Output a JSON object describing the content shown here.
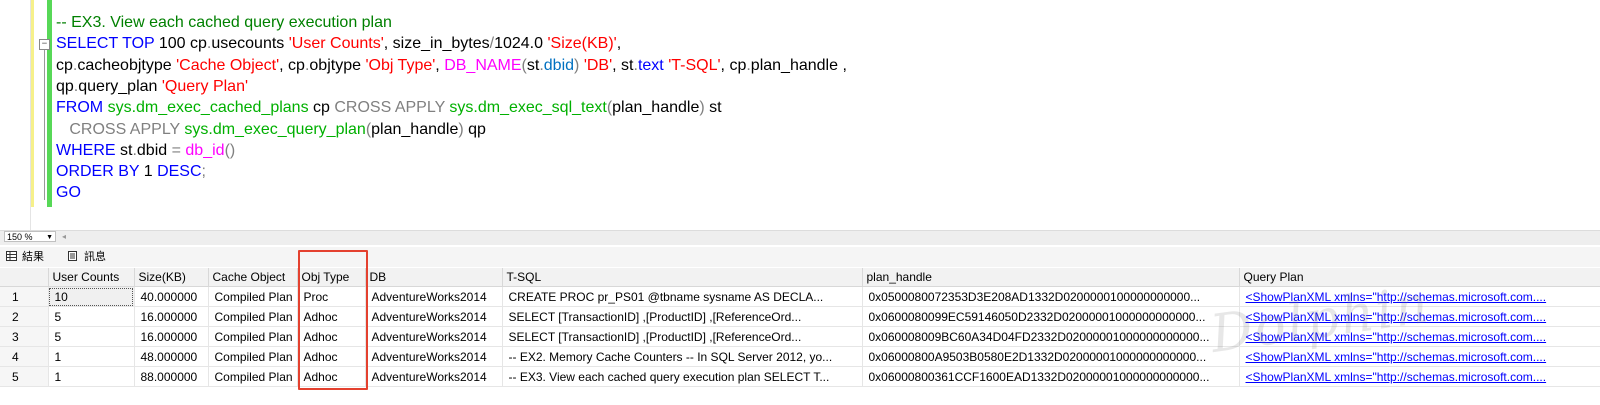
{
  "editor": {
    "lines": [
      [
        {
          "t": "-- EX3. View each cached query execution plan",
          "c": "cmt"
        }
      ],
      [
        {
          "t": "SELECT",
          "c": "kw"
        },
        {
          "t": " ",
          "c": "plain"
        },
        {
          "t": "TOP",
          "c": "kw"
        },
        {
          "t": " 100 cp",
          "c": "plain"
        },
        {
          "t": ".",
          "c": "gray"
        },
        {
          "t": "usecounts ",
          "c": "plain"
        },
        {
          "t": "'User Counts'",
          "c": "str"
        },
        {
          "t": ", size_in_bytes",
          "c": "plain"
        },
        {
          "t": "/",
          "c": "gray"
        },
        {
          "t": "1024.0 ",
          "c": "plain"
        },
        {
          "t": "'Size(KB)'",
          "c": "str"
        },
        {
          "t": ",",
          "c": "plain"
        }
      ],
      [
        {
          "t": "cp",
          "c": "plain"
        },
        {
          "t": ".",
          "c": "gray"
        },
        {
          "t": "cacheobjtype ",
          "c": "plain"
        },
        {
          "t": "'Cache Object'",
          "c": "str"
        },
        {
          "t": ", cp",
          "c": "plain"
        },
        {
          "t": ".",
          "c": "gray"
        },
        {
          "t": "objtype ",
          "c": "plain"
        },
        {
          "t": "'Obj Type'",
          "c": "str"
        },
        {
          "t": ", ",
          "c": "plain"
        },
        {
          "t": "DB_NAME",
          "c": "fn"
        },
        {
          "t": "(",
          "c": "gray"
        },
        {
          "t": "st",
          "c": "plain"
        },
        {
          "t": ".",
          "c": "gray"
        },
        {
          "t": "dbid",
          "c": "teal"
        },
        {
          "t": ")",
          "c": "gray"
        },
        {
          "t": " ",
          "c": "plain"
        },
        {
          "t": "'DB'",
          "c": "str"
        },
        {
          "t": ", st",
          "c": "plain"
        },
        {
          "t": ".",
          "c": "gray"
        },
        {
          "t": "text",
          "c": "kw"
        },
        {
          "t": " ",
          "c": "plain"
        },
        {
          "t": "'T-SQL'",
          "c": "str"
        },
        {
          "t": ", cp",
          "c": "plain"
        },
        {
          "t": ".",
          "c": "gray"
        },
        {
          "t": "plan_handle ,",
          "c": "plain"
        }
      ],
      [
        {
          "t": "qp",
          "c": "plain"
        },
        {
          "t": ".",
          "c": "gray"
        },
        {
          "t": "query_plan ",
          "c": "plain"
        },
        {
          "t": "'Query Plan'",
          "c": "str"
        }
      ],
      [
        {
          "t": "FROM",
          "c": "kw"
        },
        {
          "t": " ",
          "c": "plain"
        },
        {
          "t": "sys.dm_exec_cached_plans",
          "c": "sys"
        },
        {
          "t": " cp ",
          "c": "plain"
        },
        {
          "t": "CROSS APPLY",
          "c": "gray"
        },
        {
          "t": " ",
          "c": "plain"
        },
        {
          "t": "sys.dm_exec_sql_text",
          "c": "sys"
        },
        {
          "t": "(",
          "c": "gray"
        },
        {
          "t": "plan_handle",
          "c": "plain"
        },
        {
          "t": ")",
          "c": "gray"
        },
        {
          "t": " st",
          "c": "plain"
        }
      ],
      [
        {
          "t": "   ",
          "c": "plain"
        },
        {
          "t": "CROSS APPLY",
          "c": "gray"
        },
        {
          "t": " ",
          "c": "plain"
        },
        {
          "t": "sys.dm_exec_query_plan",
          "c": "sys"
        },
        {
          "t": "(",
          "c": "gray"
        },
        {
          "t": "plan_handle",
          "c": "plain"
        },
        {
          "t": ")",
          "c": "gray"
        },
        {
          "t": " qp",
          "c": "plain"
        }
      ],
      [
        {
          "t": "WHERE",
          "c": "kw"
        },
        {
          "t": " st",
          "c": "plain"
        },
        {
          "t": ".",
          "c": "gray"
        },
        {
          "t": "dbid ",
          "c": "plain"
        },
        {
          "t": "=",
          "c": "gray"
        },
        {
          "t": " ",
          "c": "plain"
        },
        {
          "t": "db_id",
          "c": "fn"
        },
        {
          "t": "()",
          "c": "gray"
        }
      ],
      [
        {
          "t": "ORDER BY",
          "c": "kw"
        },
        {
          "t": " 1 ",
          "c": "plain"
        },
        {
          "t": "DESC",
          "c": "kw"
        },
        {
          "t": ";",
          "c": "gray"
        }
      ],
      [
        {
          "t": "GO",
          "c": "kw"
        }
      ]
    ]
  },
  "zoom": {
    "value": "150 %"
  },
  "tabs": {
    "results_label": "結果",
    "messages_label": "訊息"
  },
  "grid": {
    "columns": [
      "",
      "User Counts",
      "Size(KB)",
      "Cache Object",
      "Obj Type",
      "DB",
      "T-SQL",
      "plan_handle",
      "Query Plan"
    ],
    "rows": [
      [
        "1",
        "10",
        "40.000000",
        "Compiled Plan",
        "Proc",
        "AdventureWorks2014",
        "CREATE PROC pr_PS01   @tbname sysname  AS   DECLA...",
        "0x0500080072353D3E208AD1332D0200000100000000000...",
        "<ShowPlanXML xmlns=\"http://schemas.microsoft.com...."
      ],
      [
        "2",
        "5",
        "16.000000",
        "Compiled Plan",
        "Adhoc",
        "AdventureWorks2014",
        "SELECT [TransactionID]      ,[ProductID]      ,[ReferenceOrd...",
        "0x0600080099EC59146050D2332D02000001000000000000...",
        "<ShowPlanXML xmlns=\"http://schemas.microsoft.com...."
      ],
      [
        "3",
        "5",
        "16.000000",
        "Compiled Plan",
        "Adhoc",
        "AdventureWorks2014",
        "SELECT [TransactionID]      ,[ProductID]      ,[ReferenceOrd...",
        "0x060008009BC60A34D04FD2332D02000001000000000000...",
        "<ShowPlanXML xmlns=\"http://schemas.microsoft.com...."
      ],
      [
        "4",
        "1",
        "48.000000",
        "Compiled Plan",
        "Adhoc",
        "AdventureWorks2014",
        "-- EX2. Memory Cache Counters  -- In SQL Server 2012, yo...",
        "0x06000800A9503B0580E2D1332D02000001000000000000...",
        "<ShowPlanXML xmlns=\"http://schemas.microsoft.com...."
      ],
      [
        "5",
        "1",
        "88.000000",
        "Compiled Plan",
        "Adhoc",
        "AdventureWorks2014",
        "-- EX3. View each cached query execution plan  SELECT T...",
        "0x06000800361CCF1600EAD1332D02000001000000000000...",
        "<ShowPlanXML xmlns=\"http://schemas.microsoft.com...."
      ]
    ]
  },
  "colors": {
    "highlight": "#e4412f",
    "keyword": "#0000ff",
    "string": "#ff0000",
    "function": "#ff00ff",
    "system_object": "#00b000",
    "comment": "#008000"
  }
}
